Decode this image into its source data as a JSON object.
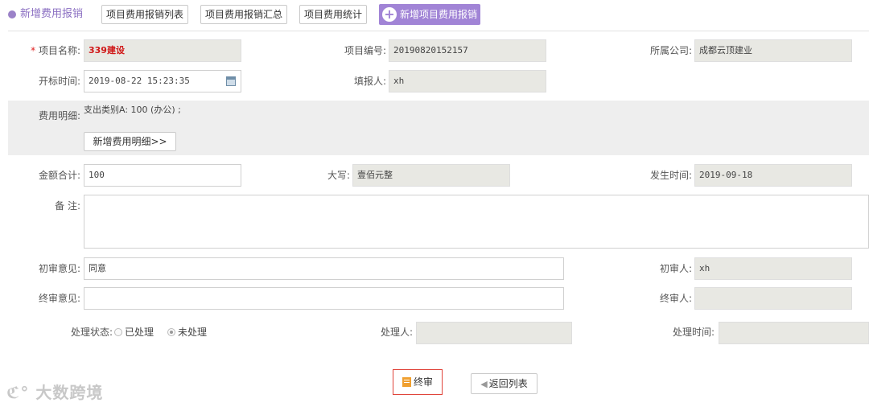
{
  "header": {
    "title": "新增费用报销",
    "tabs": [
      "项目费用报销列表",
      "项目费用报销汇总",
      "项目费用统计"
    ],
    "primary_button": "新增项目费用报销"
  },
  "form": {
    "project_name": {
      "required_mark": "*",
      "label": "项目名称:",
      "value": "339建设"
    },
    "project_no": {
      "label": "项目编号:",
      "value": "20190820152157"
    },
    "company": {
      "label": "所属公司:",
      "value": "成都云顶建业"
    },
    "bid_time": {
      "label": "开标时间:",
      "value": "2019-08-22 15:23:35"
    },
    "reporter": {
      "label": "填报人:",
      "value": "xh"
    },
    "expense_detail": {
      "label": "费用明细:",
      "lines": [
        "支出类别A: 100 (办公) ;"
      ],
      "add_button": "新增费用明细>>"
    },
    "total": {
      "label": "金额合计:",
      "value": "100"
    },
    "uppercase": {
      "label": "大写:",
      "value": "壹佰元整"
    },
    "occur_time": {
      "label": "发生时间:",
      "value": "2019-09-18"
    },
    "remark": {
      "label": "备 注:",
      "value": ""
    },
    "first_opinion": {
      "label": "初审意见:",
      "value": "同意"
    },
    "first_reviewer": {
      "label": "初审人:",
      "value": "xh"
    },
    "final_opinion": {
      "label": "终审意见:",
      "value": ""
    },
    "final_reviewer": {
      "label": "终审人:",
      "value": ""
    },
    "status": {
      "label": "处理状态:",
      "options": [
        "已处理",
        "未处理"
      ],
      "selected": "未处理"
    },
    "handler": {
      "label": "处理人:",
      "value": ""
    },
    "handle_time": {
      "label": "处理时间:",
      "value": ""
    }
  },
  "actions": {
    "final_review": "终审",
    "back": "返回列表"
  },
  "watermark": "大数跨境",
  "colors": {
    "accent": "#a184d6",
    "required": "#e02020",
    "final_border": "#e0443a"
  }
}
